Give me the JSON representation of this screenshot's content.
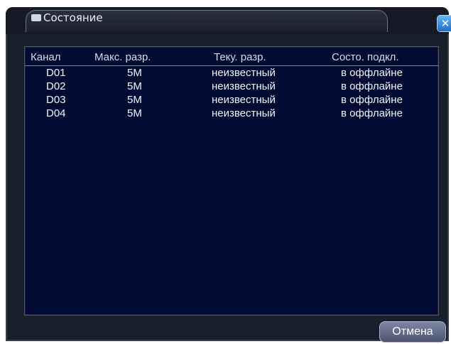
{
  "window": {
    "title": "Состояние"
  },
  "table": {
    "headers": {
      "channel": "Канал",
      "max_res": "Макс. разр.",
      "cur_res": "Теку. разр.",
      "conn_state": "Состо. подкл."
    },
    "rows": [
      {
        "channel": "D01",
        "max_res": "5M",
        "cur_res": "неизвестный",
        "conn_state": "в оффлайне"
      },
      {
        "channel": "D02",
        "max_res": "5M",
        "cur_res": "неизвестный",
        "conn_state": "в оффлайне"
      },
      {
        "channel": "D03",
        "max_res": "5M",
        "cur_res": "неизвестный",
        "conn_state": "в оффлайне"
      },
      {
        "channel": "D04",
        "max_res": "5M",
        "cur_res": "неизвестный",
        "conn_state": "в оффлайне"
      }
    ]
  },
  "buttons": {
    "cancel_label": "Отмена",
    "close_icon": "close-icon"
  },
  "colors": {
    "panel_bg": "#000a33",
    "window_bg": "#1a1f2c",
    "close_accent": "#1e6fc4"
  }
}
